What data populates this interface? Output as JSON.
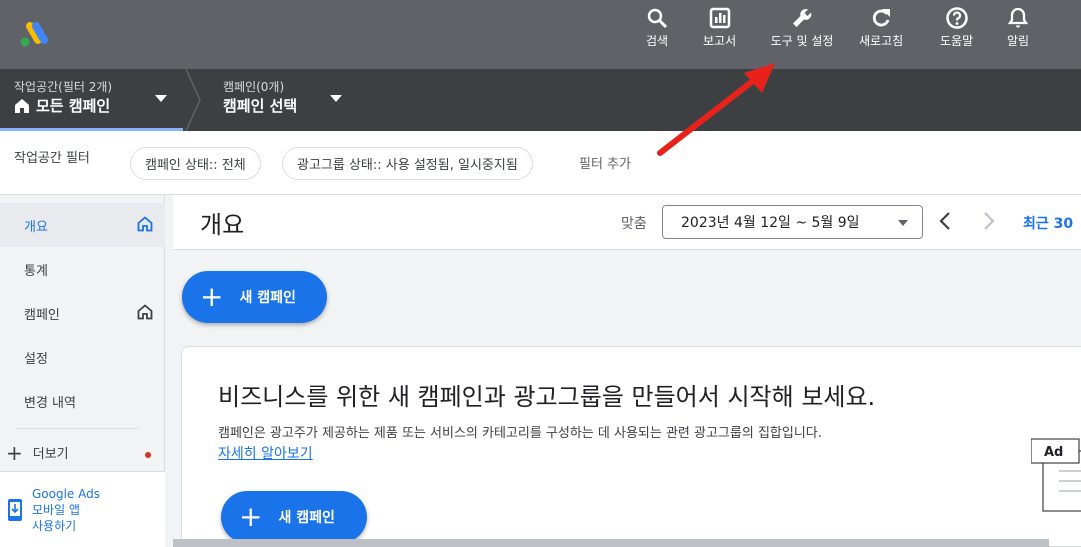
{
  "topbar": {
    "actions": [
      {
        "label": "검색",
        "icon": "search-icon"
      },
      {
        "label": "보고서",
        "icon": "reports-icon"
      },
      {
        "label": "도구 및 설정",
        "icon": "wrench-icon"
      },
      {
        "label": "새로고침",
        "icon": "refresh-icon"
      },
      {
        "label": "도움말",
        "icon": "help-icon"
      },
      {
        "label": "알림",
        "icon": "bell-icon"
      }
    ]
  },
  "breadcrumb": {
    "workspace": {
      "small": "작업공간(필터 2개)",
      "big": "모든 캠페인"
    },
    "campaign": {
      "small": "캠페인(0개)",
      "big": "캠페인 선택"
    }
  },
  "filters": {
    "label": "작업공간 필터",
    "chips": [
      "캠페인 상태:: 전체",
      "광고그룹 상태:: 사용 설정됨, 일시중지됨"
    ],
    "add_filter": "필터 추가"
  },
  "sidebar": {
    "items": [
      {
        "label": "개요",
        "active": true,
        "home": true
      },
      {
        "label": "통계",
        "active": false,
        "home": false
      },
      {
        "label": "캠페인",
        "active": false,
        "home": true
      },
      {
        "label": "설정",
        "active": false,
        "home": false
      },
      {
        "label": "변경 내역",
        "active": false,
        "home": false
      }
    ],
    "more": "더보기",
    "mobile": {
      "line1": "Google Ads",
      "line2": "모바일 앱",
      "line3": "사용하기"
    }
  },
  "main": {
    "title": "개요",
    "custom_label": "맞춤",
    "date_range": "2023년 4월 12일 ~ 5월 9일",
    "recent_label": "최근 30",
    "new_campaign": "새 캠페인",
    "card": {
      "title": "비즈니스를 위한 새 캠페인과 광고그룹을 만들어서 시작해 보세요.",
      "description": "캠페인은 광고주가 제공하는 제품 또는 서비스의 카테고리를 구성하는 데 사용되는 관련 광고그룹의 집합입니다.",
      "link": "자세히 알아보기",
      "button": "새 캠페인",
      "illustration_label": "Ad"
    }
  },
  "colors": {
    "topbar": "#5f6368",
    "crumbbar": "#3c4043",
    "accent": "#1a73e8",
    "annotation_arrow": "#e8221b"
  }
}
